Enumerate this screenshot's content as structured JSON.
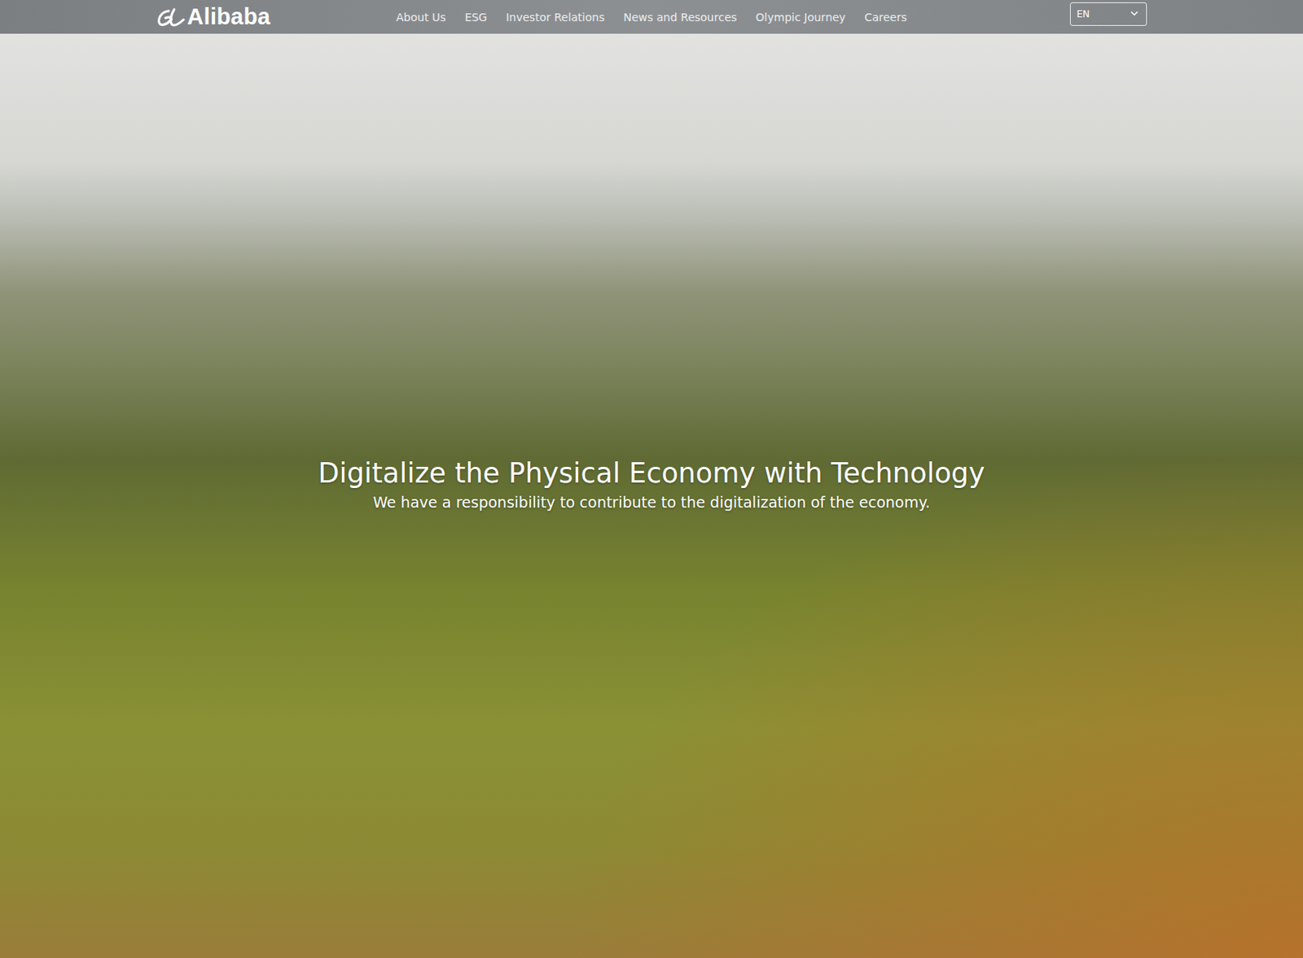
{
  "header": {
    "logo": "Alibaba",
    "nav": [
      "About Us",
      "ESG",
      "Investor Relations",
      "News and Resources",
      "Olympic Journey",
      "Careers"
    ],
    "language": "EN"
  },
  "hero": {
    "title": "Digitalize the Physical Economy with Technology",
    "subtitle": "We have a responsibility to contribute to the digitalization of the economy."
  }
}
